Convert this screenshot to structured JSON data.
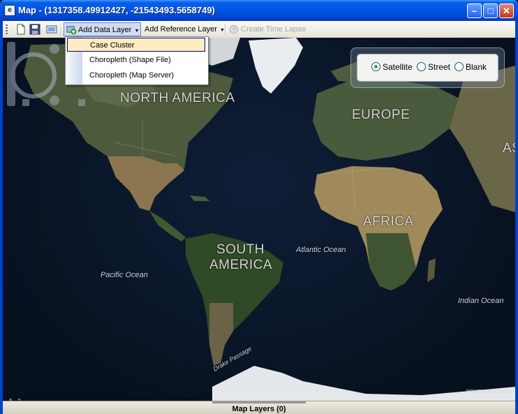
{
  "window": {
    "title": "Map - (1317358.49912427, -21543493.5658749)",
    "icon": "app-icon",
    "controls": [
      "minimize-icon",
      "maximize-icon",
      "close-icon"
    ]
  },
  "toolbar": {
    "add_data_layer": "Add Data Layer",
    "add_reference_layer": "Add Reference Layer",
    "create_time_lapse": "Create Time Lapse"
  },
  "menu": {
    "items": [
      "Case Cluster",
      "Choropleth (Shape File)",
      "Choropleth (Map Server)"
    ]
  },
  "map": {
    "labels": {
      "north_america": "NORTH AMERICA",
      "south_america_1": "SOUTH",
      "south_america_2": "AMERICA",
      "europe": "EUROPE",
      "africa": "AFRICA",
      "asia_partial": "AS",
      "atlantic": "Atlantic Ocean",
      "pacific": "Pacific Ocean",
      "indian": "Indian Ocean",
      "drake": "Drake Passage"
    },
    "style_options": [
      "Satellite",
      "Street",
      "Blank"
    ],
    "selected_style": "Satellite",
    "logo": "bing",
    "attribution": "POWERED BY esri"
  },
  "status": {
    "text": "Map Layers (0)"
  }
}
